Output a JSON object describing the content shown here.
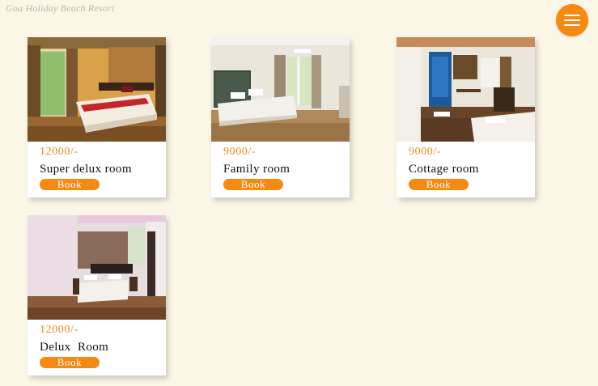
{
  "brand": "Goa Holiday Beach Resort",
  "menu": {
    "icon": "hamburger-menu-icon"
  },
  "rooms": [
    {
      "price": "12000/-",
      "name": "Super delux room",
      "book_label": "Book"
    },
    {
      "price": "9000/-",
      "name": "Family room",
      "book_label": "Book"
    },
    {
      "price": "9000/-",
      "name": "Cottage room",
      "book_label": "Book"
    },
    {
      "price": "12000/-",
      "name": "Delux  Room",
      "book_label": "Book"
    }
  ],
  "colors": {
    "accent": "#f58a12",
    "price": "#f08a1c",
    "background": "#fbf6e6"
  }
}
